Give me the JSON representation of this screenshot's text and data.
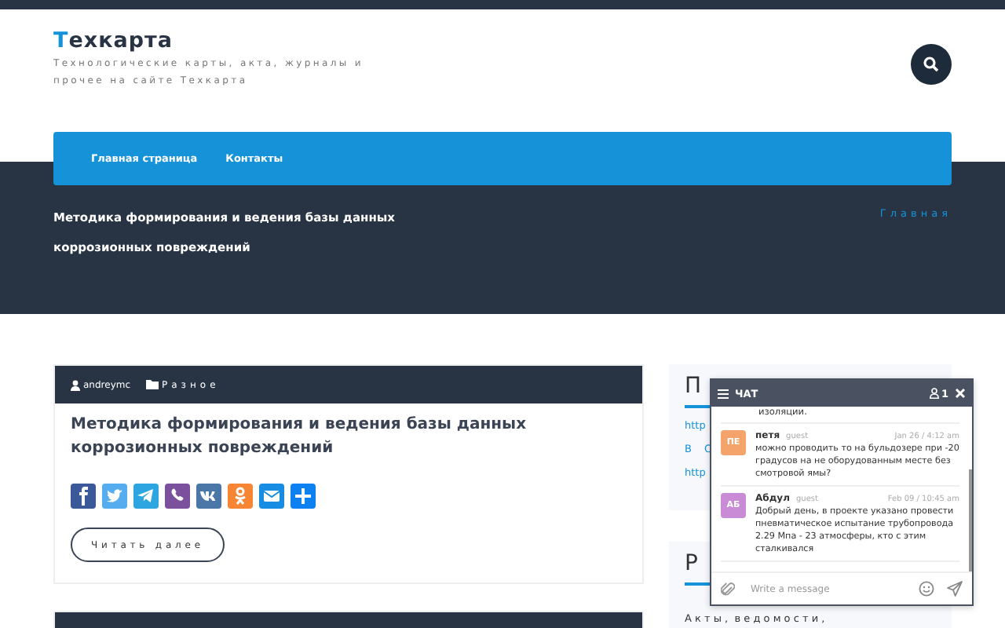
{
  "site": {
    "logo_first": "Т",
    "logo_rest": "ехкарта",
    "tagline": "Технологические карты, акта, журналы и прочее на сайте Техкарта"
  },
  "nav": [
    {
      "label": "Главная страница"
    },
    {
      "label": "Контакты"
    }
  ],
  "hero": {
    "title": "Методика формирования и ведения базы данных коррозионных повреждений",
    "breadcrumb": "Главная"
  },
  "posts": [
    {
      "author": "andreymc",
      "category": "Разное",
      "title": "Методика формирования и ведения базы данных коррозионных повреждений",
      "button": "Читать далее"
    }
  ],
  "sidebar": [
    {
      "heading": "П",
      "links": [
        "http",
        "В С",
        "http"
      ]
    },
    {
      "heading": "Р",
      "links": [
        "А к т ы ,  в е д о м о с т и ,"
      ]
    }
  ],
  "chat": {
    "title": "ЧАТ",
    "users": "1",
    "prev_tail": "изоляции.",
    "messages": [
      {
        "initials": "ПЕ",
        "color": "#f4a46a",
        "name": "петя",
        "role": "guest",
        "time": "Jan 26 / 4:12 am",
        "text": "можно проводить то на бульдозере при -20 градусов на не оборудованным месте без смотровой ямы?"
      },
      {
        "initials": "АБ",
        "color": "#c98ad6",
        "name": "Абдул",
        "role": "guest",
        "time": "Feb 09 / 10:45 am",
        "text": "Добрый день, в проекте указано провести пневматическое испытание трубопровода 2.29 Мпа - 23 атмосферы, кто с этим сталкивался"
      }
    ],
    "placeholder": "Write a message"
  }
}
